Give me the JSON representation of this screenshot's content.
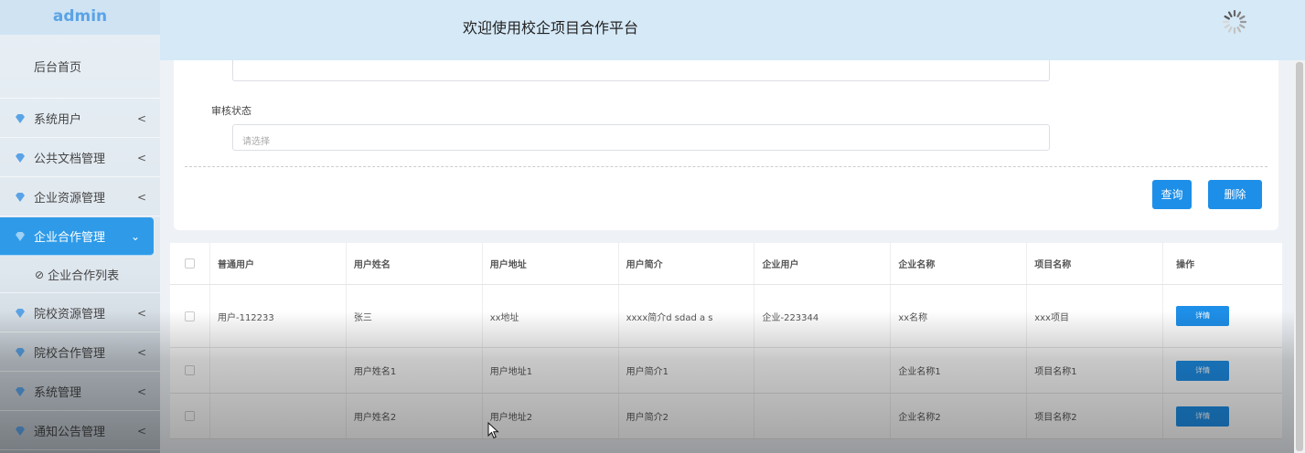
{
  "app": {
    "brand": "admin",
    "title": "欢迎使用校企项目合作平台"
  },
  "colors": {
    "accent": "#1e8fe8",
    "sidebar_active": "#2f9be8",
    "brand_text": "#5aa3e6",
    "topbar": "#d6e9f7"
  },
  "sidebar": {
    "home": "后台首页",
    "items": [
      {
        "label": "系统用户",
        "icon": "gem-icon"
      },
      {
        "label": "公共文档管理",
        "icon": "gem-icon"
      },
      {
        "label": "企业资源管理",
        "icon": "gem-icon"
      },
      {
        "label": "企业合作管理",
        "icon": "gem-icon",
        "active": true
      },
      {
        "label": "院校资源管理",
        "icon": "gem-icon"
      },
      {
        "label": "院校合作管理",
        "icon": "gem-icon"
      },
      {
        "label": "系统管理",
        "icon": "gem-icon"
      },
      {
        "label": "通知公告管理",
        "icon": "gem-icon"
      }
    ],
    "sub_item": "企业合作列表",
    "chevron_collapsed": "<",
    "chevron_expanded": "⌄"
  },
  "filter": {
    "status_label": "审核状态",
    "status_placeholder": "请选择",
    "query_label": "查询",
    "delete_label": "删除"
  },
  "table": {
    "columns": [
      "普通用户",
      "用户姓名",
      "用户地址",
      "用户简介",
      "企业用户",
      "企业名称",
      "项目名称",
      "操作"
    ],
    "detail_label": "详情",
    "rows": [
      [
        "用户-112233",
        "张三",
        "xx地址",
        "xxxx简介d sdad a s",
        "企业-223344",
        "xx名称",
        "xxx项目"
      ],
      [
        "",
        "用户姓名1",
        "用户地址1",
        "用户简介1",
        "",
        "企业名称1",
        "项目名称1"
      ],
      [
        "",
        "用户姓名2",
        "用户地址2",
        "用户简介2",
        "",
        "企业名称2",
        "项目名称2"
      ]
    ]
  }
}
